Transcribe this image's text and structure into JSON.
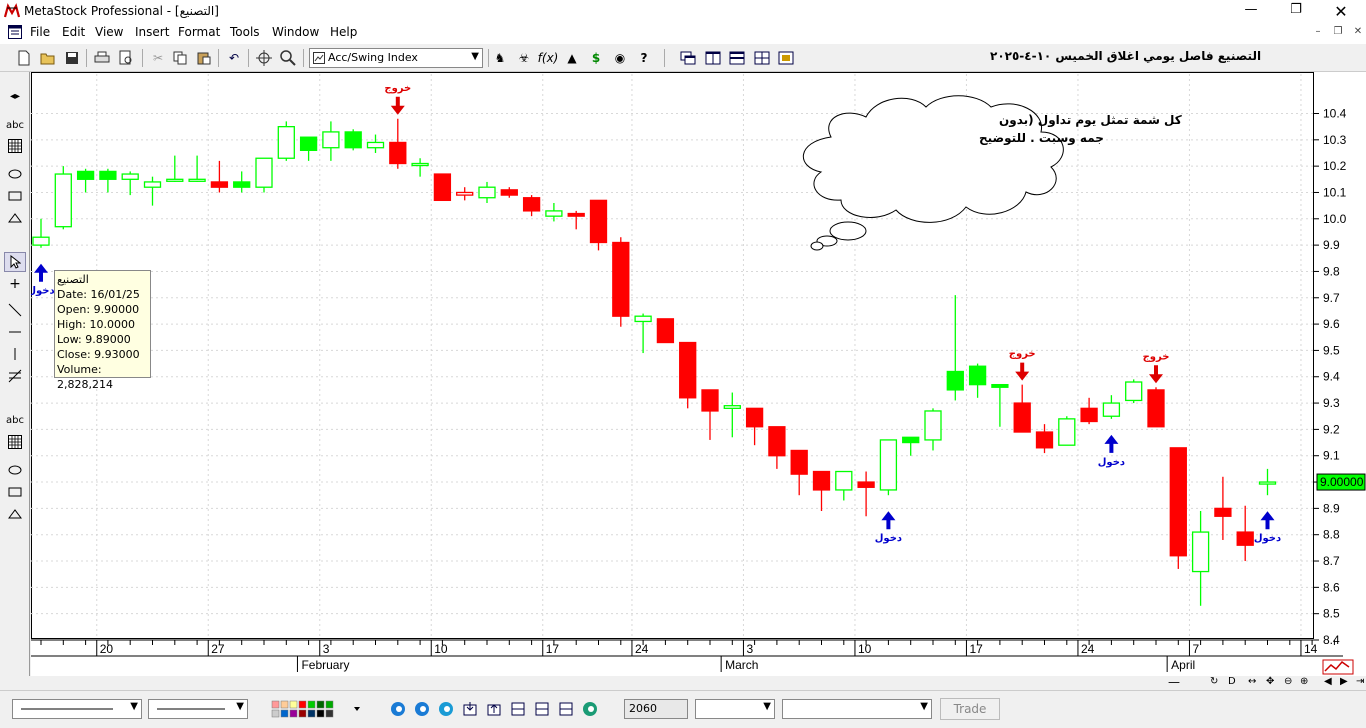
{
  "window": {
    "title": "MetaStock Professional - [التصنيع]"
  },
  "menu": [
    "File",
    "Edit",
    "View",
    "Insert",
    "Format",
    "Tools",
    "Window",
    "Help"
  ],
  "toolbar": {
    "indicator": "Acc/Swing Index",
    "chart_title": "التصنيع فاصل يومي اغلاق الخميس ١٠-٤-٢٠٢٥"
  },
  "left_tools": {
    "text_tool_1": "abc",
    "text_tool_2": "abc"
  },
  "tooltip": {
    "name": "التصنيع",
    "date": "Date: 16/01/25",
    "open": "Open: 9.90000",
    "high": "High: 10.0000",
    "low": "Low: 9.89000",
    "close": "Close: 9.93000",
    "volume": "Volume: 2,828,214"
  },
  "callout": {
    "text_line1": "كل شمة تمثل يوم تداول (بدون",
    "text_line2": "جمه وسبت . للتوضيح"
  },
  "signals": {
    "entry": "دخول",
    "exit": "خروج"
  },
  "last_price": "9.00000",
  "statusbar": {
    "bars": "2060",
    "trade": "Trade",
    "sb_d": "D"
  },
  "colors": {
    "up": "#00ff00",
    "down": "#ff0000",
    "entry_arrow": "#0000cc",
    "exit_arrow": "#dd0000"
  },
  "chart_data": {
    "type": "candlestick",
    "title": "التصنيع فاصل يومي اغلاق الخميس ١٠-٤-٢٠٢٥",
    "ylim": [
      8.4,
      10.55
    ],
    "yticks": [
      10.4,
      10.3,
      10.2,
      10.1,
      10.0,
      9.9,
      9.8,
      9.7,
      9.6,
      9.5,
      9.4,
      9.3,
      9.2,
      9.1,
      9.0,
      8.9,
      8.8,
      8.7,
      8.6,
      8.5,
      8.4
    ],
    "ytick_labels": [
      "10.4",
      "10.3",
      "10.2",
      "10.1",
      "10.0",
      "9.9",
      "9.8",
      "9.7",
      "9.6",
      "9.5",
      "9.4",
      "9.3",
      "9.2",
      "9.1",
      "9.0",
      "8.9",
      "8.8",
      "8.7",
      "8.6",
      "8.5",
      "8.4"
    ],
    "x_day_labels": [
      {
        "label": "20",
        "index": 3
      },
      {
        "label": "27",
        "index": 8
      },
      {
        "label": "3",
        "index": 13
      },
      {
        "label": "10",
        "index": 18
      },
      {
        "label": "17",
        "index": 23
      },
      {
        "label": "24",
        "index": 27
      },
      {
        "label": "3",
        "index": 32
      },
      {
        "label": "10",
        "index": 37
      },
      {
        "label": "17",
        "index": 42
      },
      {
        "label": "24",
        "index": 47
      },
      {
        "label": "7",
        "index": 52
      },
      {
        "label": "14",
        "index": 57
      }
    ],
    "month_labels": [
      {
        "label": "February",
        "index": 12
      },
      {
        "label": "March",
        "index": 31
      },
      {
        "label": "April",
        "index": 51
      }
    ],
    "candles": [
      {
        "o": 9.9,
        "h": 10.0,
        "l": 9.89,
        "c": 9.93,
        "up": true,
        "fill": false
      },
      {
        "o": 9.97,
        "h": 10.2,
        "l": 9.96,
        "c": 10.17,
        "up": true,
        "fill": false
      },
      {
        "o": 10.15,
        "h": 10.19,
        "l": 10.1,
        "c": 10.18,
        "up": true,
        "fill": true
      },
      {
        "o": 10.15,
        "h": 10.19,
        "l": 10.1,
        "c": 10.18,
        "up": true,
        "fill": true
      },
      {
        "o": 10.15,
        "h": 10.18,
        "l": 10.09,
        "c": 10.17,
        "up": true,
        "fill": false
      },
      {
        "o": 10.12,
        "h": 10.16,
        "l": 10.05,
        "c": 10.14,
        "up": true,
        "fill": false
      },
      {
        "o": 10.15,
        "h": 10.24,
        "l": 10.14,
        "c": 10.15,
        "up": true,
        "fill": false
      },
      {
        "o": 10.15,
        "h": 10.24,
        "l": 10.14,
        "c": 10.15,
        "up": true,
        "fill": false
      },
      {
        "o": 10.14,
        "h": 10.22,
        "l": 10.1,
        "c": 10.12,
        "up": false,
        "fill": true
      },
      {
        "o": 10.12,
        "h": 10.18,
        "l": 10.1,
        "c": 10.14,
        "up": true,
        "fill": true
      },
      {
        "o": 10.12,
        "h": 10.23,
        "l": 10.1,
        "c": 10.23,
        "up": true,
        "fill": false
      },
      {
        "o": 10.23,
        "h": 10.37,
        "l": 10.22,
        "c": 10.35,
        "up": true,
        "fill": false
      },
      {
        "o": 10.26,
        "h": 10.31,
        "l": 10.22,
        "c": 10.31,
        "up": true,
        "fill": true
      },
      {
        "o": 10.27,
        "h": 10.37,
        "l": 10.22,
        "c": 10.33,
        "up": true,
        "fill": false
      },
      {
        "o": 10.27,
        "h": 10.34,
        "l": 10.26,
        "c": 10.33,
        "up": true,
        "fill": true
      },
      {
        "o": 10.27,
        "h": 10.32,
        "l": 10.25,
        "c": 10.29,
        "up": true,
        "fill": false
      },
      {
        "o": 10.29,
        "h": 10.38,
        "l": 10.19,
        "c": 10.21,
        "up": false,
        "fill": true
      },
      {
        "o": 10.21,
        "h": 10.23,
        "l": 10.16,
        "c": 10.21,
        "up": true,
        "fill": false
      },
      {
        "o": 10.17,
        "h": 10.17,
        "l": 10.07,
        "c": 10.07,
        "up": false,
        "fill": true
      },
      {
        "o": 10.1,
        "h": 10.12,
        "l": 10.07,
        "c": 10.09,
        "up": false,
        "fill": false
      },
      {
        "o": 10.08,
        "h": 10.14,
        "l": 10.06,
        "c": 10.12,
        "up": true,
        "fill": false
      },
      {
        "o": 10.11,
        "h": 10.12,
        "l": 10.08,
        "c": 10.09,
        "up": false,
        "fill": true
      },
      {
        "o": 10.08,
        "h": 10.09,
        "l": 10.01,
        "c": 10.03,
        "up": false,
        "fill": true
      },
      {
        "o": 10.01,
        "h": 10.06,
        "l": 9.99,
        "c": 10.03,
        "up": true,
        "fill": false
      },
      {
        "o": 10.02,
        "h": 10.03,
        "l": 9.96,
        "c": 10.01,
        "up": false,
        "fill": true
      },
      {
        "o": 10.07,
        "h": 10.07,
        "l": 9.88,
        "c": 9.91,
        "up": false,
        "fill": true
      },
      {
        "o": 9.91,
        "h": 9.93,
        "l": 9.59,
        "c": 9.63,
        "up": false,
        "fill": true
      },
      {
        "o": 9.61,
        "h": 9.64,
        "l": 9.49,
        "c": 9.63,
        "up": true,
        "fill": false
      },
      {
        "o": 9.62,
        "h": 9.62,
        "l": 9.53,
        "c": 9.53,
        "up": false,
        "fill": true
      },
      {
        "o": 9.53,
        "h": 9.53,
        "l": 9.28,
        "c": 9.32,
        "up": false,
        "fill": true
      },
      {
        "o": 9.35,
        "h": 9.35,
        "l": 9.16,
        "c": 9.27,
        "up": false,
        "fill": true
      },
      {
        "o": 9.28,
        "h": 9.34,
        "l": 9.17,
        "c": 9.29,
        "up": true,
        "fill": false
      },
      {
        "o": 9.28,
        "h": 9.28,
        "l": 9.14,
        "c": 9.21,
        "up": false,
        "fill": true
      },
      {
        "o": 9.21,
        "h": 9.21,
        "l": 9.05,
        "c": 9.1,
        "up": false,
        "fill": true
      },
      {
        "o": 9.12,
        "h": 9.12,
        "l": 8.95,
        "c": 9.03,
        "up": false,
        "fill": true
      },
      {
        "o": 9.04,
        "h": 9.04,
        "l": 8.89,
        "c": 8.97,
        "up": false,
        "fill": true
      },
      {
        "o": 8.97,
        "h": 9.04,
        "l": 8.93,
        "c": 9.04,
        "up": true,
        "fill": false
      },
      {
        "o": 9.0,
        "h": 9.04,
        "l": 8.87,
        "c": 8.98,
        "up": false,
        "fill": true
      },
      {
        "o": 8.97,
        "h": 9.16,
        "l": 8.95,
        "c": 9.16,
        "up": true,
        "fill": false
      },
      {
        "o": 9.15,
        "h": 9.17,
        "l": 9.1,
        "c": 9.17,
        "up": true,
        "fill": true
      },
      {
        "o": 9.16,
        "h": 9.28,
        "l": 9.12,
        "c": 9.27,
        "up": true,
        "fill": false
      },
      {
        "o": 9.35,
        "h": 9.71,
        "l": 9.31,
        "c": 9.42,
        "up": true,
        "fill": true
      },
      {
        "o": 9.37,
        "h": 9.45,
        "l": 9.32,
        "c": 9.44,
        "up": true,
        "fill": true
      },
      {
        "o": 9.37,
        "h": 9.37,
        "l": 9.21,
        "c": 9.36,
        "up": true,
        "fill": true
      },
      {
        "o": 9.3,
        "h": 9.37,
        "l": 9.19,
        "c": 9.19,
        "up": false,
        "fill": true
      },
      {
        "o": 9.19,
        "h": 9.22,
        "l": 9.11,
        "c": 9.13,
        "up": false,
        "fill": true
      },
      {
        "o": 9.14,
        "h": 9.25,
        "l": 9.14,
        "c": 9.24,
        "up": true,
        "fill": false
      },
      {
        "o": 9.28,
        "h": 9.32,
        "l": 9.22,
        "c": 9.23,
        "up": false,
        "fill": true
      },
      {
        "o": 9.25,
        "h": 9.33,
        "l": 9.24,
        "c": 9.3,
        "up": true,
        "fill": false
      },
      {
        "o": 9.31,
        "h": 9.39,
        "l": 9.3,
        "c": 9.38,
        "up": true,
        "fill": false
      },
      {
        "o": 9.35,
        "h": 9.36,
        "l": 9.21,
        "c": 9.21,
        "up": false,
        "fill": true
      },
      {
        "o": 9.13,
        "h": 9.13,
        "l": 8.67,
        "c": 8.72,
        "up": false,
        "fill": true
      },
      {
        "o": 8.66,
        "h": 8.89,
        "l": 8.53,
        "c": 8.81,
        "up": true,
        "fill": false
      },
      {
        "o": 8.9,
        "h": 9.02,
        "l": 8.78,
        "c": 8.87,
        "up": false,
        "fill": true
      },
      {
        "o": 8.81,
        "h": 8.91,
        "l": 8.7,
        "c": 8.76,
        "up": false,
        "fill": true
      },
      {
        "o": 9.0,
        "h": 9.05,
        "l": 8.95,
        "c": 9.0,
        "up": true,
        "fill": false
      }
    ],
    "entries": [
      0,
      38,
      48,
      55
    ],
    "exits": [
      16,
      44,
      50
    ]
  }
}
